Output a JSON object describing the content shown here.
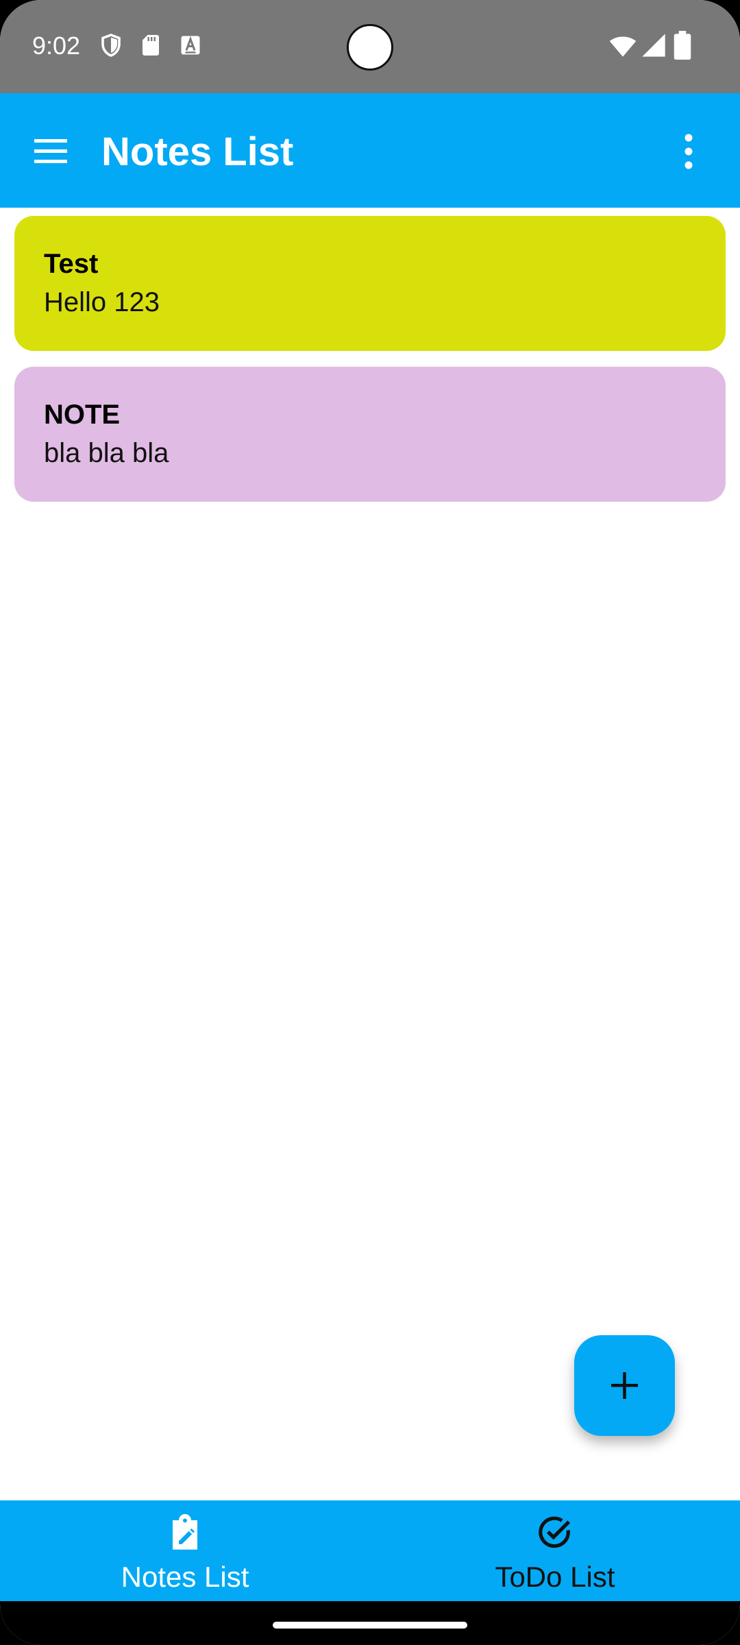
{
  "status_bar": {
    "time": "9:02",
    "icons": [
      "shield-icon",
      "sd-card-icon",
      "text-a-icon",
      "wifi-icon",
      "signal-icon",
      "battery-icon"
    ]
  },
  "app_bar": {
    "title": "Notes List",
    "menu_icon": "hamburger-menu-icon",
    "overflow_icon": "more-vert-icon",
    "color": "#03a9f4"
  },
  "notes": [
    {
      "title": "Test",
      "body": "Hello 123",
      "color": "#d8e00b"
    },
    {
      "title": "NOTE",
      "body": "bla bla bla",
      "color": "#e0bbe4"
    }
  ],
  "fab": {
    "icon": "plus-icon",
    "color": "#03a9f4"
  },
  "bottom_nav": {
    "items": [
      {
        "label": "Notes List",
        "icon": "clipboard-edit-icon",
        "selected": true
      },
      {
        "label": "ToDo List",
        "icon": "check-circle-icon",
        "selected": false
      }
    ]
  }
}
